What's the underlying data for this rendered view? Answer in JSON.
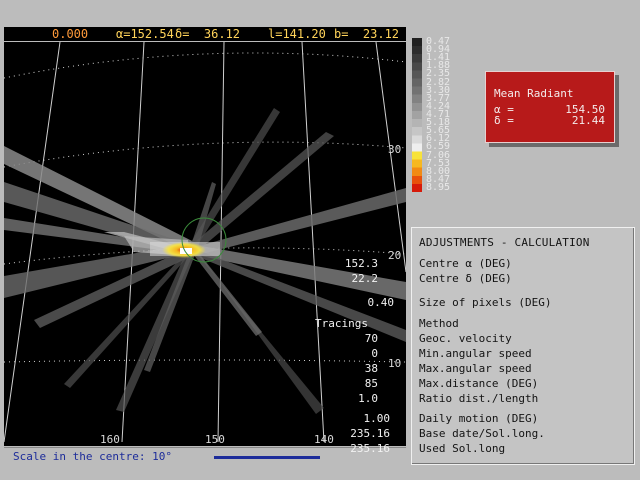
{
  "status": {
    "time": "0.000",
    "alpha": "α=152.54",
    "delta": "δ=  36.12",
    "l": "l=141.20",
    "b": "b=  23.12"
  },
  "map": {
    "ra_ticks": [
      "160",
      "150",
      "140"
    ],
    "dec_ticks": [
      "30",
      "20",
      "10"
    ]
  },
  "scale": {
    "label": "Scale in the centre:  10°"
  },
  "legend": {
    "values": [
      "0.47",
      "0.94",
      "1.41",
      "1.88",
      "2.35",
      "2.82",
      "3.30",
      "3.77",
      "4.24",
      "4.71",
      "5.18",
      "5.65",
      "6.12",
      "6.59",
      "7.06",
      "7.53",
      "8.00",
      "8.47",
      "8.95"
    ],
    "colors": [
      "#202020",
      "#2c2c2c",
      "#3a3a3a",
      "#484848",
      "#565656",
      "#646464",
      "#727272",
      "#828282",
      "#929292",
      "#a2a2a2",
      "#b4b4b4",
      "#c6c6c6",
      "#dadada",
      "#eeeeee",
      "#f8e33a",
      "#f6b820",
      "#f18a14",
      "#e8500c",
      "#d61a0a"
    ]
  },
  "radiant": {
    "title": "Mean Radiant",
    "alpha_label": "α =",
    "alpha_value": "154.50",
    "delta_label": "δ =",
    "delta_value": "21.44"
  },
  "adjust": {
    "title": "ADJUSTMENTS - CALCULATION",
    "rows": [
      {
        "label": "Centre α (DEG)",
        "value": "152.3"
      },
      {
        "label": "Centre δ (DEG)",
        "value": "22.2"
      },
      {
        "label": "Size of pixels (DEG)",
        "value": "0.40"
      },
      {
        "label": "Method",
        "value": "Tracings"
      },
      {
        "label": "Geoc. velocity",
        "value": "70"
      },
      {
        "label": "Min.angular speed",
        "value": "0"
      },
      {
        "label": "Max.angular speed",
        "value": "38"
      },
      {
        "label": "Max.distance (DEG)",
        "value": "85"
      },
      {
        "label": "Ratio dist./length",
        "value": "1.0"
      },
      {
        "label": "Daily motion (DEG)",
        "value": "1.00"
      },
      {
        "label": "Base date/Sol.long.",
        "value": "235.16"
      },
      {
        "label": "Used Sol.long",
        "value": "235.16"
      }
    ]
  }
}
